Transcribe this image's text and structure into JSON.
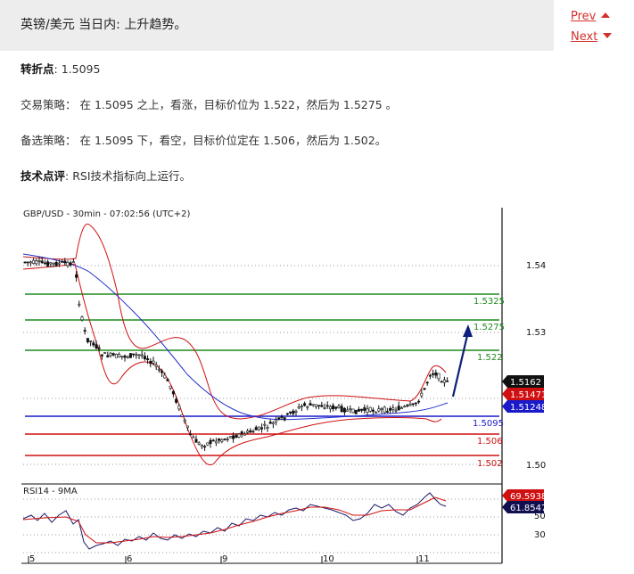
{
  "header": {
    "title": "英镑/美元 当日内: 上升趋势。",
    "prev_label": "Prev",
    "next_label": "Next"
  },
  "analysis": {
    "pivot_label": "转折点",
    "pivot_value": ": 1.5095",
    "strategy_label": "交易策略：",
    "strategy_text": "在 1.5095 之上，看涨，目标价位为 1.522，然后为 1.5275 。",
    "alt_label": "备选策略：",
    "alt_text": "在 1.5095 下，看空，目标价位定在 1.506，然后为 1.502。",
    "comment_label": "技术点评",
    "comment_text": ": RSI技术指标向上运行。"
  },
  "chart_data": {
    "type": "candlestick",
    "title": "GBP/USD - 30min - 07:02:56 (UTC+2)",
    "price_axis": {
      "ticks": [
        "1.54",
        "1.53",
        "1.50"
      ],
      "range": [
        1.4985,
        1.5435
      ]
    },
    "x_ticks": [
      "5",
      "6",
      "9",
      "10",
      "11"
    ],
    "levels": [
      {
        "value": "1.5325",
        "color": "#1f8a1f"
      },
      {
        "value": "1.5275",
        "color": "#1f8a1f"
      },
      {
        "value": "1.522",
        "color": "#1f8a1f"
      },
      {
        "value": "1.5095",
        "color": "#1a1ac8"
      },
      {
        "value": "1.506",
        "color": "#d01010"
      },
      {
        "value": "1.502",
        "color": "#d01010"
      }
    ],
    "badges": [
      {
        "value": "1.5162",
        "bg": "#111111"
      },
      {
        "value": "1.51471",
        "bg": "#d01010"
      },
      {
        "value": "1.51248",
        "bg": "#1a1ac8"
      }
    ],
    "rsi": {
      "title": "RSI14 - 9MA",
      "ticks": [
        "50",
        "30"
      ],
      "badges": [
        {
          "value": "69.5938",
          "bg": "#d01010"
        },
        {
          "value": "61.8547",
          "bg": "#101050"
        }
      ]
    }
  }
}
